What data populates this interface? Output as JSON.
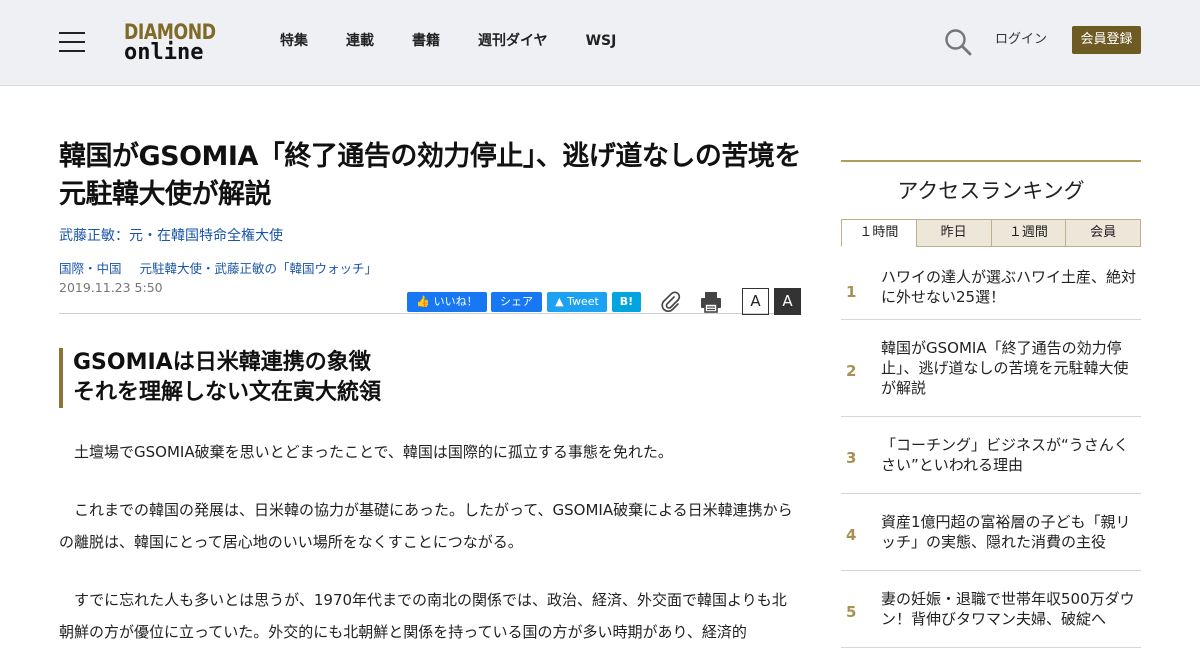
{
  "header": {
    "logo_line1": "DIAMOND",
    "logo_line2": "online",
    "nav": [
      "特集",
      "連載",
      "書籍",
      "週刊ダイヤ",
      "WSJ"
    ],
    "login_label": "ログイン",
    "register_label": "会員登録"
  },
  "article": {
    "title": "韓国がGSOMIA「終了通告の効力停止」、逃げ道なしの苦境を元駐韓大使が解説",
    "author": "武藤正敏：元・在韓国特命全権大使",
    "categories": [
      "国際・中国",
      "元駐韓大使・武藤正敏の「韓国ウォッチ」"
    ],
    "date": "2019.11.23 5:50",
    "share": {
      "like": "いいね！",
      "share": "シェア",
      "tweet": "Tweet",
      "hatena": "B!"
    },
    "font_small": "A",
    "font_large": "A",
    "subheading_line1": "GSOMIAは日米韓連携の象徴",
    "subheading_line2": "それを理解しない文在寅大統領",
    "paragraphs": [
      "土壇場でGSOMIA破棄を思いとどまったことで、韓国は国際的に孤立する事態を免れた。",
      "これまでの韓国の発展は、日米韓の協力が基礎にあった。したがって、GSOMIA破棄による日米韓連携からの離脱は、韓国にとって居心地のいい場所をなくすことにつながる。",
      "すでに忘れた人も多いとは思うが、1970年代までの南北の関係では、政治、経済、外交面で韓国よりも北朝鮮の方が優位に立っていた。外交的にも北朝鮮と関係を持っている国の方が多い時期があり、経済的"
    ]
  },
  "sidebar": {
    "ranking_title": "アクセスランキング",
    "tabs": [
      "１時間",
      "昨日",
      "１週間",
      "会員"
    ],
    "items": [
      {
        "num": "1",
        "text": "ハワイの達人が選ぶハワイ土産、絶対に外せない25選！"
      },
      {
        "num": "2",
        "text": "韓国がGSOMIA「終了通告の効力停止」、逃げ道なしの苦境を元駐韓大使が解説"
      },
      {
        "num": "3",
        "text": "「コーチング」ビジネスが“うさんくさい”といわれる理由"
      },
      {
        "num": "4",
        "text": "資産1億円超の富裕層の子ども「親リッチ」の実態、隠れた消費の主役"
      },
      {
        "num": "5",
        "text": "妻の妊娠・退職で世帯年収500万ダウン！背伸びタワマン夫婦、破綻へ"
      }
    ]
  }
}
